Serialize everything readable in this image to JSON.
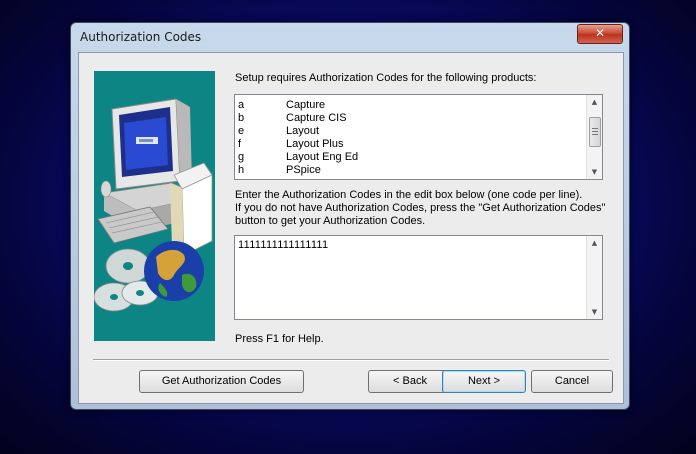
{
  "window": {
    "title": "Authorization Codes",
    "close_glyph": "✕"
  },
  "instructions": {
    "header": "Setup requires Authorization Codes for the following products:",
    "line1": "Enter the Authorization Codes in the edit box below (one code per line).",
    "line2": "If you do not have Authorization Codes, press the \"Get Authorization Codes\"",
    "line3": "button to get your Authorization Codes."
  },
  "products": [
    {
      "code": "a",
      "name": "Capture"
    },
    {
      "code": "b",
      "name": "Capture CIS"
    },
    {
      "code": "e",
      "name": "Layout"
    },
    {
      "code": "f",
      "name": "Layout Plus"
    },
    {
      "code": "g",
      "name": "Layout Eng Ed"
    },
    {
      "code": "h",
      "name": "PSpice"
    }
  ],
  "codes_input": {
    "value": "1111111111111111"
  },
  "help_text": "Press F1 for Help.",
  "buttons": {
    "get_codes": "Get Authorization Codes",
    "back": "< Back",
    "next": "Next >",
    "cancel": "Cancel"
  },
  "icons": {
    "picture": "computer-cd-globe-illustration",
    "close": "close-icon"
  }
}
